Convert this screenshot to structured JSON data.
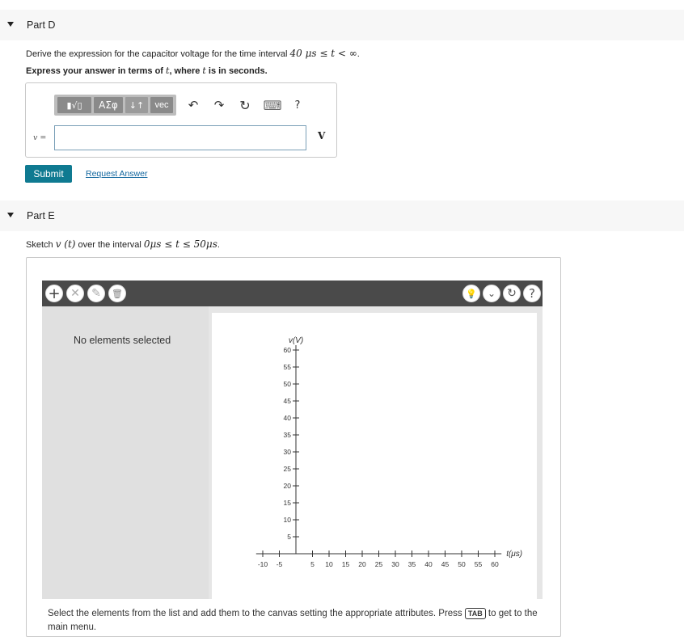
{
  "partD": {
    "header": "Part D",
    "question": {
      "prefix": "Derive the expression for the capacitor voltage for the time interval ",
      "math": "40 μs ≤ t < ∞",
      "suffix": "."
    },
    "hint": {
      "prefix": "Express your answer in terms of ",
      "var1": "t",
      "middle": ", where ",
      "var2": "t",
      "suffix": " is in seconds."
    },
    "toolbar": {
      "templates_label": "▮√▯",
      "greek_label": "ΑΣφ",
      "subsup_label": "↓↑",
      "vec_label": "vec",
      "undo_icon": "↶",
      "redo_icon": "↷",
      "reset_icon": "↻",
      "keyboard_icon": "⌨",
      "help_label": "?"
    },
    "answer_label": "v =",
    "answer_value": "",
    "unit": "V",
    "submit_label": "Submit",
    "request_label": "Request Answer"
  },
  "partE": {
    "header": "Part E",
    "question": {
      "prefix": "Sketch ",
      "func": "v (t)",
      "middle": " over the interval ",
      "math": "0μs ≤ t ≤ 50μs",
      "suffix": "."
    },
    "tools": {
      "add_label": "+",
      "delete_label": "✕",
      "edit_label": "✎",
      "trash_label": "🗑",
      "hint_label": "💡",
      "dropdown_label": "⌄",
      "reset_label": "↻",
      "help_label": "?"
    },
    "no_elements": "No elements selected",
    "graph": {
      "y_label": "v(V)",
      "x_label": "t(μs)",
      "y_ticks": [
        "60",
        "55",
        "50",
        "45",
        "40",
        "35",
        "30",
        "25",
        "20",
        "15",
        "10",
        "5"
      ],
      "x_ticks_neg": [
        "-10",
        "-5"
      ],
      "x_ticks_pos": [
        "5",
        "10",
        "15",
        "20",
        "25",
        "30",
        "35",
        "40",
        "45",
        "50",
        "55",
        "60"
      ]
    },
    "instructions": {
      "prefix": "Select the elements from the list and add them to the canvas setting the appropriate attributes. Press ",
      "key": "TAB",
      "suffix": " to get to the main menu."
    }
  },
  "colors": {
    "submit": "#0f7a91",
    "link": "#11669e",
    "toolbar": "#4a4a4a"
  }
}
